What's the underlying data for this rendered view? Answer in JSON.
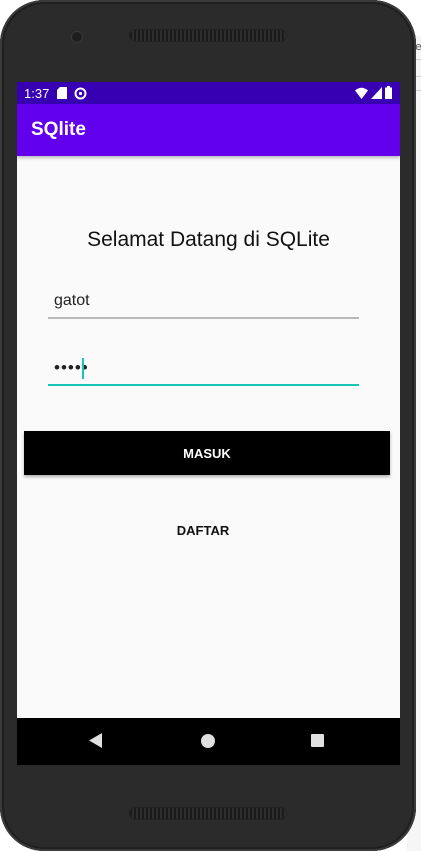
{
  "status_bar": {
    "time": "1:37",
    "background": "#3700b3"
  },
  "app_bar": {
    "title": "SQlite",
    "background": "#6200ee"
  },
  "login": {
    "welcome_text": "Selamat Datang di SQLite",
    "username_value": "gatot",
    "password_value": "•••••",
    "accent_color": "#16c7b5",
    "login_button": "MASUK",
    "register_button": "DAFTAR"
  },
  "edge_text": "e"
}
